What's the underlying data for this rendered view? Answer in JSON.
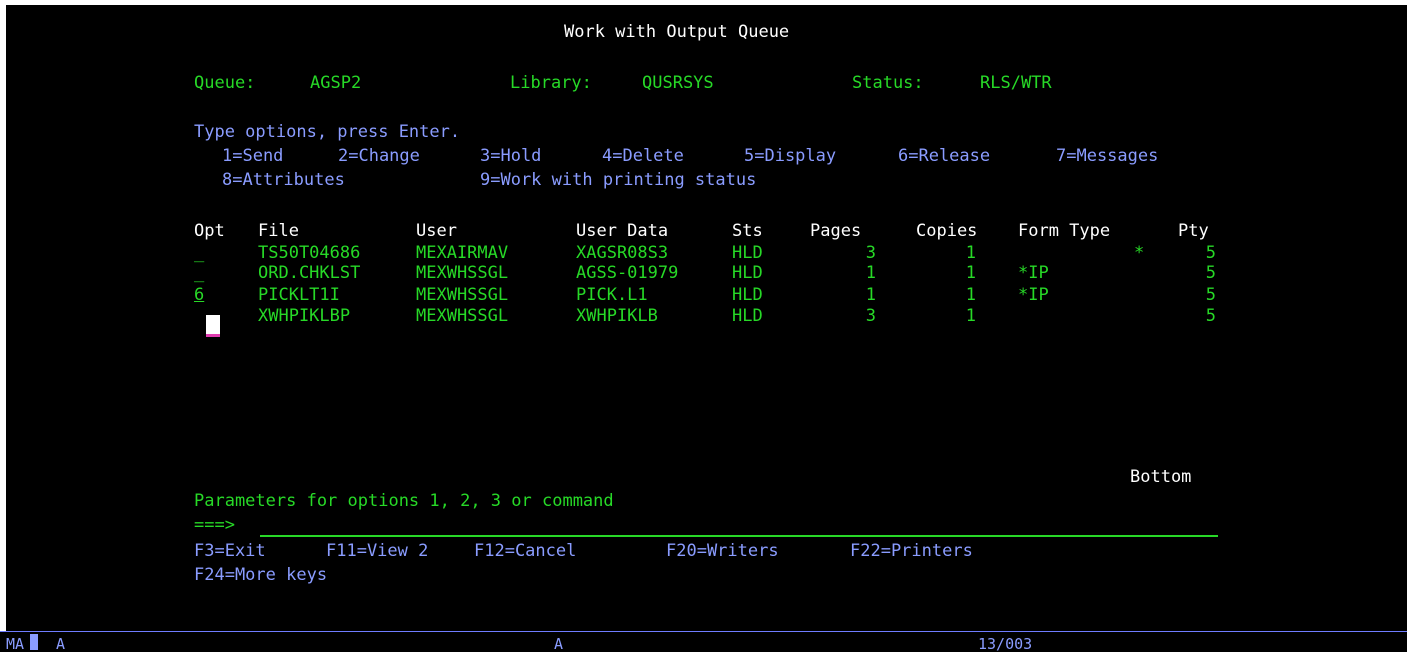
{
  "title": "Work with Output Queue",
  "queue": {
    "label": "Queue:",
    "value": "AGSP2"
  },
  "library": {
    "label": "Library:",
    "value": "QUSRSYS"
  },
  "status": {
    "label": "Status:",
    "value": "RLS/WTR"
  },
  "instructions": "Type options, press Enter.",
  "options_line1": [
    {
      "key": "1=Send"
    },
    {
      "key": "2=Change"
    },
    {
      "key": "3=Hold"
    },
    {
      "key": "4=Delete"
    },
    {
      "key": "5=Display"
    },
    {
      "key": "6=Release"
    },
    {
      "key": "7=Messages"
    }
  ],
  "options_line2": [
    {
      "key": "8=Attributes"
    },
    {
      "key": "9=Work with printing status"
    }
  ],
  "columns": {
    "opt": "Opt",
    "file": "File",
    "user": "User",
    "user_data": "User Data",
    "sts": "Sts",
    "pages": "Pages",
    "copies": "Copies",
    "form_type": "Form Type",
    "pty": "Pty"
  },
  "rows": [
    {
      "opt": "_",
      "file": "TS50T04686",
      "user": "MEXAIRMAV",
      "user_data": "XAGSR08S3",
      "sts": "HLD",
      "pages": "3",
      "copies": "1",
      "form_type": "*",
      "pty": "5"
    },
    {
      "opt": "_",
      "file": "ORD.CHKLST",
      "user": "MEXWHSSGL",
      "user_data": "AGSS-01979",
      "sts": "HLD",
      "pages": "1",
      "copies": "1",
      "form_type": "*IP",
      "pty": "5"
    },
    {
      "opt": "6",
      "file": "PICKLT1I",
      "user": "MEXWHSSGL",
      "user_data": "PICK.L1",
      "sts": "HLD",
      "pages": "1",
      "copies": "1",
      "form_type": "*IP",
      "pty": "5"
    },
    {
      "opt": "",
      "file": "XWHPIKLBP",
      "user": "MEXWHSSGL",
      "user_data": "XWHPIKLB",
      "sts": "HLD",
      "pages": "3",
      "copies": "1",
      "form_type": "",
      "pty": "5"
    }
  ],
  "bottom_label": "Bottom",
  "parameters_label": "Parameters for options 1, 2, 3 or command",
  "command_prompt": "===>",
  "command_value": "",
  "fkeys_line1": [
    {
      "key": "F3=Exit"
    },
    {
      "key": "F11=View 2"
    },
    {
      "key": "F12=Cancel"
    },
    {
      "key": "F20=Writers"
    },
    {
      "key": "F22=Printers"
    }
  ],
  "fkeys_line2": [
    {
      "key": "F24=More keys"
    }
  ],
  "status_bar": {
    "mode": "MA",
    "indicator1": "A",
    "indicator2": "A",
    "cursor_pos": "13/003"
  },
  "colors": {
    "background": "#000000",
    "green": "#27d927",
    "blue": "#8a9cff",
    "white": "#ffffff"
  }
}
